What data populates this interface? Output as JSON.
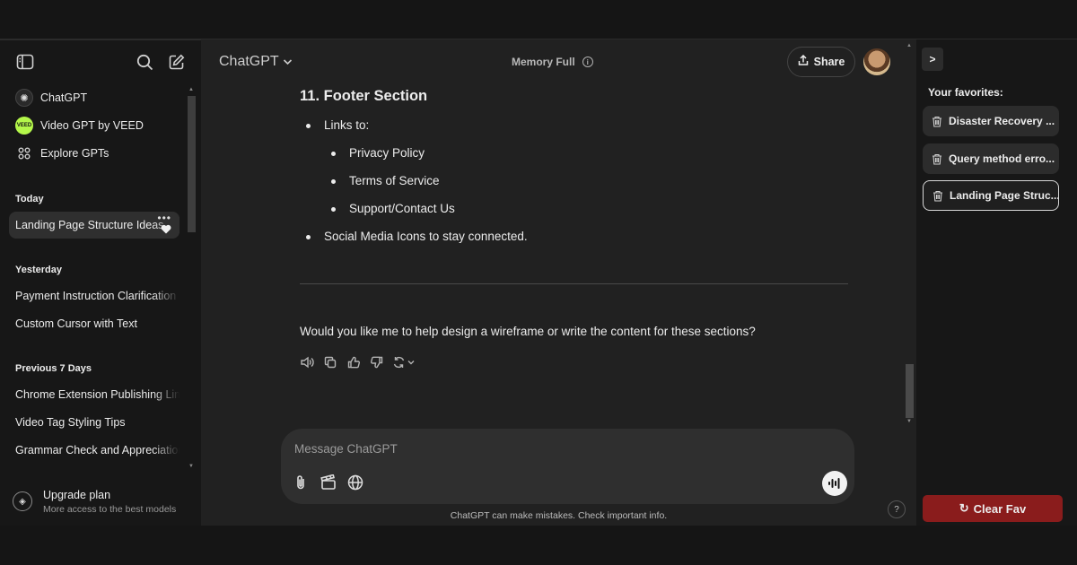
{
  "header": {
    "model_name": "ChatGPT",
    "memory_label": "Memory Full",
    "share_label": "Share"
  },
  "sidebar": {
    "nav": [
      {
        "label": "ChatGPT",
        "icon": "openai-logo-icon"
      },
      {
        "label": "Video GPT by VEED",
        "icon": "veed-logo-icon",
        "icon_text": "VEED"
      },
      {
        "label": "Explore GPTs",
        "icon": "grid-icon"
      }
    ],
    "sections": {
      "today": "Today",
      "yesterday": "Yesterday",
      "previous_7": "Previous 7 Days"
    },
    "today_chats": [
      "Landing Page Structure Ideas"
    ],
    "yesterday_chats": [
      "Payment Instruction Clarification",
      "Custom Cursor with Text"
    ],
    "previous_chats": [
      "Chrome Extension Publishing Limits",
      "Video Tag Styling Tips",
      "Grammar Check and Appreciation"
    ],
    "upgrade": {
      "title": "Upgrade plan",
      "subtitle": "More access to the best models"
    }
  },
  "conversation": {
    "heading": "11. Footer Section",
    "items": {
      "links_to": "Links to:",
      "privacy": "Privacy Policy",
      "terms": "Terms of Service",
      "support": "Support/Contact Us",
      "social": "Social Media Icons to stay connected."
    },
    "question": "Would you like me to help design a wireframe or write the content for these sections?"
  },
  "composer": {
    "placeholder": "Message ChatGPT",
    "disclaimer": "ChatGPT can make mistakes. Check important info."
  },
  "favorites": {
    "toggle_label": ">",
    "title": "Your favorites:",
    "items": [
      "Disaster Recovery ...",
      "Query method erro...",
      "Landing Page Struc..."
    ],
    "active_index": 2,
    "clear_label": "Clear Fav",
    "clear_icon": "↻"
  },
  "help_label": "?",
  "colors": {
    "background": "#212121",
    "sidebar": "#171717",
    "clear_button": "#8a1c1c",
    "veed_brand": "#b4f74a"
  }
}
